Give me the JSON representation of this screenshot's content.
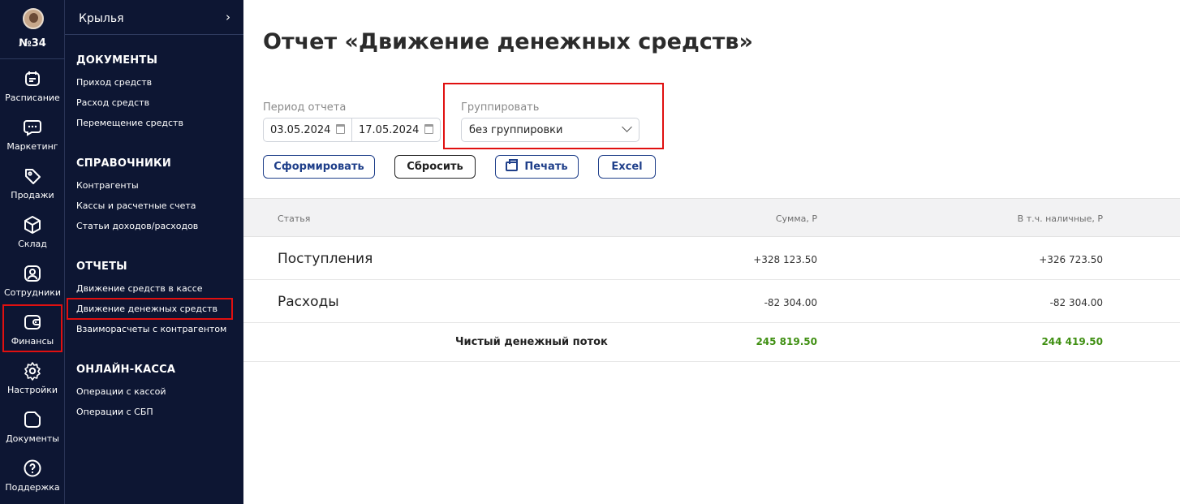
{
  "rail": {
    "studio": "№34",
    "items": [
      {
        "label": "Расписание",
        "icon": "calendar-icon"
      },
      {
        "label": "Маркетинг",
        "icon": "chat-icon"
      },
      {
        "label": "Продажи",
        "icon": "tag-icon"
      },
      {
        "label": "Склад",
        "icon": "box-icon"
      },
      {
        "label": "Сотрудники",
        "icon": "user-icon"
      },
      {
        "label": "Финансы",
        "icon": "wallet-icon"
      },
      {
        "label": "Настройки",
        "icon": "gear-icon"
      },
      {
        "label": "Документы",
        "icon": "document-icon"
      },
      {
        "label": "Поддержка",
        "icon": "help-icon"
      }
    ]
  },
  "nav": {
    "branch": "Крылья",
    "sections": [
      {
        "title": "ДОКУМЕНТЫ",
        "links": [
          "Приход средств",
          "Расход средств",
          "Перемещение средств"
        ]
      },
      {
        "title": "СПРАВОЧНИКИ",
        "links": [
          "Контрагенты",
          "Кассы и расчетные счета",
          "Статьи доходов/расходов"
        ]
      },
      {
        "title": "ОТЧЕТЫ",
        "links": [
          "Движение средств в кассе",
          "Движение денежных средств",
          "Взаиморасчеты с контрагентом"
        ]
      },
      {
        "title": "ОНЛАЙН-КАССА",
        "links": [
          "Операции с кассой",
          "Операции с СБП"
        ]
      }
    ]
  },
  "page": {
    "title": "Отчет «Движение денежных средств»",
    "period_label": "Период отчета",
    "date_from": "03.05.2024",
    "date_to": "17.05.2024",
    "group_label": "Группировать",
    "group_value": "без группировки",
    "buttons": {
      "generate": "Сформировать",
      "reset": "Сбросить",
      "print": "Печать",
      "excel": "Excel"
    }
  },
  "table": {
    "headers": {
      "article": "Статья",
      "sum": "Сумма, Р",
      "cash": "В т.ч. наличные, Р"
    },
    "rows": [
      {
        "name": "Поступления",
        "sum": "+328 123.50",
        "cash": "+326 723.50"
      },
      {
        "name": "Расходы",
        "sum": "-82 304.00",
        "cash": "-82 304.00"
      }
    ],
    "total": {
      "label": "Чистый денежный поток",
      "sum": "245 819.50",
      "cash": "244 419.50"
    }
  },
  "colors": {
    "sidebar": "#0d1633",
    "accent": "#1f3f8a",
    "positive": "#3f8f12",
    "highlight": "#e01010"
  }
}
